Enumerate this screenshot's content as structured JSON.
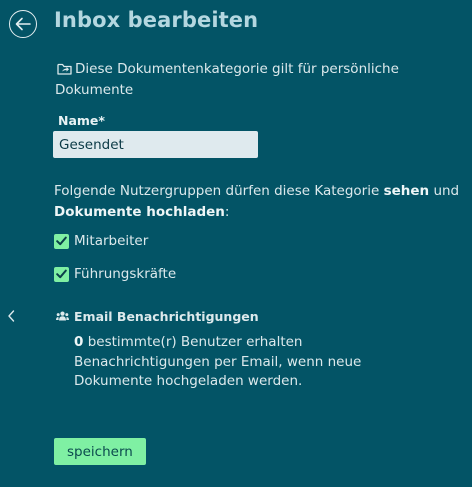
{
  "header": {
    "title": "Inbox bearbeiten",
    "back_icon": "arrow-left-circle-icon"
  },
  "info": {
    "icon": "folder-share-icon",
    "text": "Diese Dokumentenkategorie gilt für persönliche Dokumente"
  },
  "name_field": {
    "label": "Name*",
    "value": "Gesendet"
  },
  "groups": {
    "intro_before": "Folgende Nutzergruppen dürfen diese Kategorie ",
    "intro_bold1": "sehen",
    "intro_middle": " und ",
    "intro_bold2": "Dokumente hochladen",
    "intro_after": ":",
    "items": [
      {
        "label": "Mitarbeiter",
        "checked": true
      },
      {
        "label": "Führungskräfte",
        "checked": true
      }
    ]
  },
  "email": {
    "heading": "Email Benachrichtigungen",
    "icon": "users-icon",
    "count": "0",
    "text": " bestimmte(r) Benutzer erhalten Benachrichtigungen per Email, wenn neue Dokumente hochgeladen werden."
  },
  "sidebar_toggle_icon": "chevron-left-icon",
  "actions": {
    "save_label": "speichern"
  },
  "colors": {
    "background": "#035466",
    "title": "#b4d7e0",
    "accent": "#7ff0a3",
    "input_bg": "#dfeaee"
  }
}
